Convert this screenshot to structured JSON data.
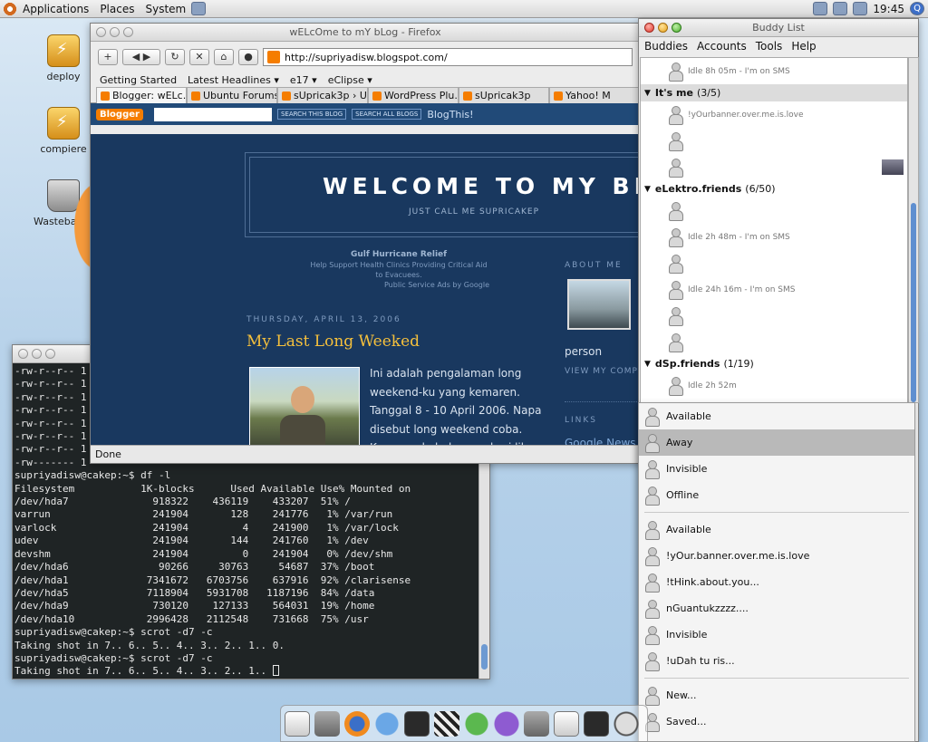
{
  "top_panel": {
    "menus": [
      "Applications",
      "Places",
      "System"
    ],
    "clock": "19:45"
  },
  "desktop": {
    "icons": [
      "deploy",
      "compiere",
      "Wastebaske"
    ]
  },
  "terminal": {
    "lines": [
      "-rw-r--r-- 1",
      "-rw-r--r-- 1",
      "-rw-r--r-- 1",
      "-rw-r--r-- 1",
      "-rw-r--r-- 1",
      "-rw-r--r-- 1",
      "-rw-r--r-- 1",
      "-rw------- 1",
      "supriyadisw@cakep:~$ df -l",
      "Filesystem           1K-blocks      Used Available Use% Mounted on",
      "/dev/hda7              918322    436119    433207  51% /",
      "varrun                 241904       128    241776   1% /var/run",
      "varlock                241904         4    241900   1% /var/lock",
      "udev                   241904       144    241760   1% /dev",
      "devshm                 241904         0    241904   0% /dev/shm",
      "/dev/hda6               90266     30763     54687  37% /boot",
      "/dev/hda1             7341672   6703756    637916  92% /clarisense",
      "/dev/hda5             7118904   5931708   1187196  84% /data",
      "/dev/hda9              730120    127133    564031  19% /home",
      "/dev/hda10            2996428   2112548    731668  75% /usr",
      "supriyadisw@cakep:~$ scrot -d7 -c",
      "Taking shot in 7.. 6.. 5.. 4.. 3.. 2.. 1.. 0.",
      "supriyadisw@cakep:~$ scrot -d7 -c"
    ],
    "last_line": "Taking shot in 7.. 6.. 5.. 4.. 3.. 2.. 1.. "
  },
  "firefox": {
    "title": "wELcOme to mY bLog - Firefox",
    "url": "http://supriyadisw.blogspot.com/",
    "bookmarks": [
      "Getting Started",
      "Latest Headlines ▾",
      "e17 ▾",
      "eClipse ▾"
    ],
    "tabs": [
      "Blogger: wELc...",
      "Ubuntu Forums ...",
      "sUpricak3p › Us...",
      "WordPress Plu...",
      "sUpricak3p",
      "Yahoo! M"
    ],
    "status": "Done",
    "blogger_bar": {
      "logo": "Blogger",
      "search_blog": "SEARCH THIS BLOG",
      "search_all": "SEARCH ALL BLOGS",
      "blog_this": "BlogThis!"
    },
    "blog": {
      "title": "WELCOME TO MY BLOG",
      "subtitle": "JUST CALL ME SUPRICAKEP",
      "ad_title": "Gulf Hurricane Relief",
      "ad_line1": "Help Support Health Clinics Providing Critical Aid",
      "ad_line2": "to Evacuees.",
      "ad_line3": "Public Service Ads by Google",
      "date": "THURSDAY, APRIL 13, 2006",
      "post_title": "My Last Long Weeked",
      "post_text": "Ini adalah pengalaman long weekend-ku yang kemaren. Tanggal 8 - 10 April 2006. Napa disebut long weekend coba. Karena ada beberapa hari libur",
      "about_heading": "ABOUT ME",
      "person": "person",
      "view_profile": "VIEW MY COMP",
      "links_heading": "LINKS",
      "link1": "Google News"
    }
  },
  "buddy_list": {
    "title": "Buddy List",
    "menus": [
      "Buddies",
      "Accounts",
      "Tools",
      "Help"
    ],
    "items": [
      {
        "kind": "buddy",
        "text": "Idle 8h 05m - I'm on SMS"
      },
      {
        "kind": "group",
        "name": "It's me",
        "count": "(3/5)",
        "selected": true
      },
      {
        "kind": "buddy",
        "text": "!yOurbanner.over.me.is.love"
      },
      {
        "kind": "buddy",
        "text": ""
      },
      {
        "kind": "buddy",
        "text": "",
        "thumb": true
      },
      {
        "kind": "group",
        "name": "eLektro.friends",
        "count": "(6/50)"
      },
      {
        "kind": "buddy",
        "text": ""
      },
      {
        "kind": "buddy",
        "text": "Idle 2h 48m - I'm on SMS"
      },
      {
        "kind": "buddy",
        "text": ""
      },
      {
        "kind": "buddy",
        "text": "Idle 24h 16m - I'm on SMS"
      },
      {
        "kind": "buddy",
        "text": ""
      },
      {
        "kind": "buddy",
        "text": ""
      },
      {
        "kind": "group",
        "name": "dSp.friends",
        "count": "(1/19)"
      },
      {
        "kind": "buddy",
        "text": "Idle 2h 52m"
      }
    ],
    "status_menu": {
      "primary": [
        "Available",
        "Away",
        "Invisible",
        "Offline"
      ],
      "highlighted": "Away",
      "saved": [
        "Available",
        "!yOur.banner.over.me.is.love",
        "!tHink.about.you...",
        "nGuantukzzzz....",
        "Invisible",
        "!uDah tu ris..."
      ],
      "actions": [
        "New...",
        "Saved..."
      ]
    }
  }
}
